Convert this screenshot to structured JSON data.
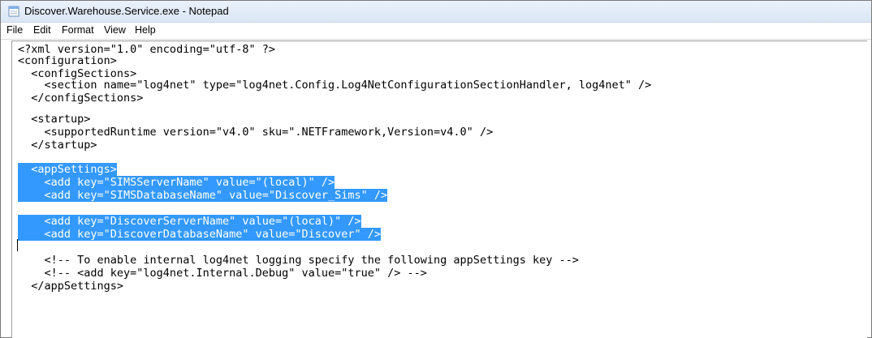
{
  "window": {
    "title": "Discover.Warehouse.Service.exe - Notepad",
    "icon": "notepad-icon"
  },
  "menu": [
    "File",
    "Edit",
    "Format",
    "View",
    "Help"
  ],
  "lines": [
    "<?xml version=\"1.0\" encoding=\"utf-8\" ?>",
    "<configuration>",
    "  <configSections>",
    "    <section name=\"log4net\" type=\"log4net.Config.Log4NetConfigurationSectionHandler, log4net\" />",
    "  </configSections>",
    "",
    "  <startup>",
    "    <supportedRuntime version=\"v4.0\" sku=\".NETFramework,Version=v4.0\" />",
    "  </startup>",
    "",
    "  <appSettings>",
    "    <add key=\"SIMSServerName\" value=\"(local)\" />",
    "    <add key=\"SIMSDatabaseName\" value=\"Discover_Sims\" />",
    "",
    "    <add key=\"DiscoverServerName\" value=\"(local)\" />",
    "    <add key=\"DiscoverDatabaseName\" value=\"Discover\" />",
    "",
    "    <!-- To enable internal log4net logging specify the following appSettings key -->",
    "    <!-- <add key=\"log4net.Internal.Debug\" value=\"true\" /> -->",
    "  </appSettings>"
  ],
  "selection_color": "#3399ff"
}
